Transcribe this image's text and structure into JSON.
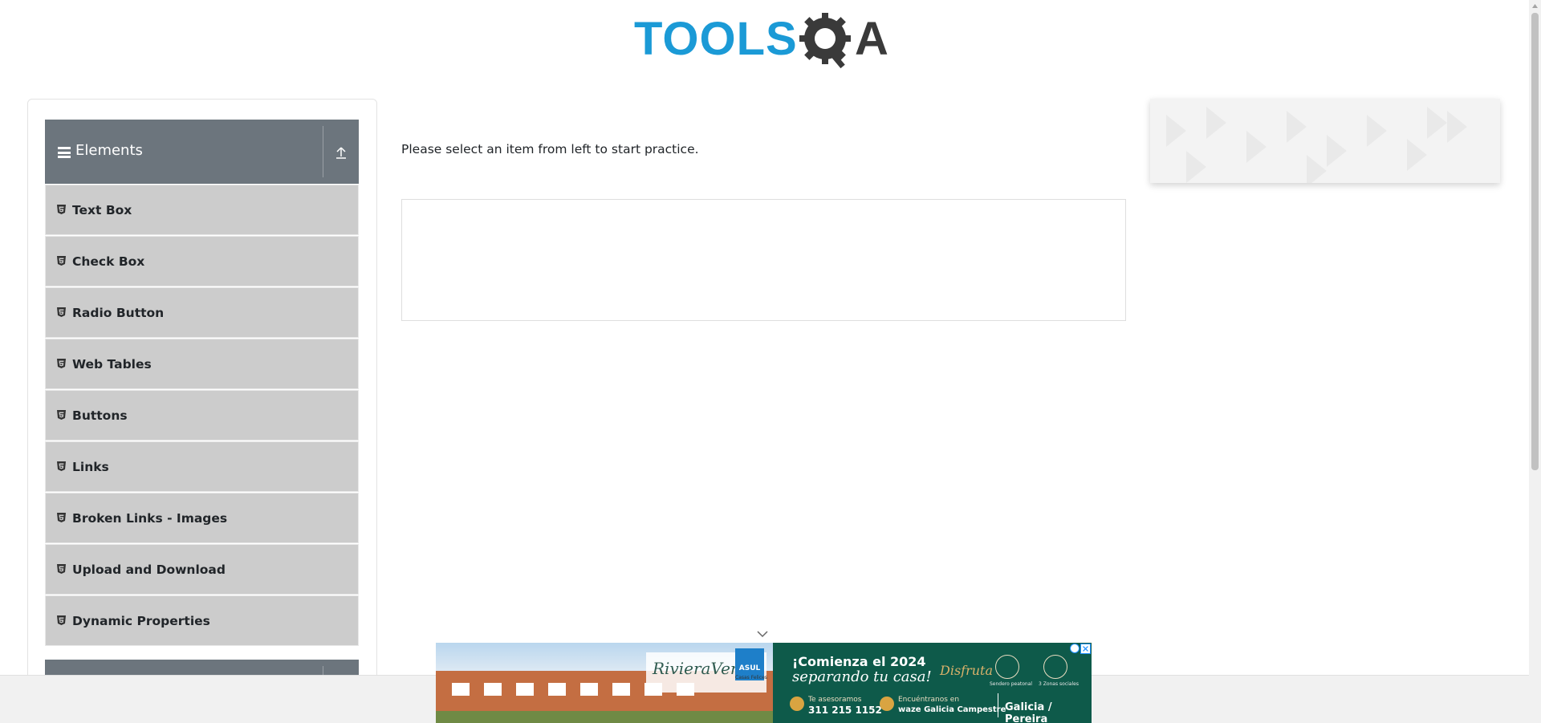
{
  "header": {
    "logo_text_tools": "TOOLS",
    "logo_text_a": "A",
    "logo_colors": {
      "tools": "#1b9ad6",
      "gear": "#3a3a3a"
    }
  },
  "sidebar": {
    "group": {
      "title": "Elements",
      "icon": "hamburger-icon",
      "toggle_icon": "collapse-up-icon"
    },
    "items": [
      {
        "label": "Text Box",
        "icon": "html5-icon"
      },
      {
        "label": "Check Box",
        "icon": "html5-icon"
      },
      {
        "label": "Radio Button",
        "icon": "html5-icon"
      },
      {
        "label": "Web Tables",
        "icon": "html5-icon"
      },
      {
        "label": "Buttons",
        "icon": "html5-icon"
      },
      {
        "label": "Links",
        "icon": "html5-icon"
      },
      {
        "label": "Broken Links - Images",
        "icon": "html5-icon"
      },
      {
        "label": "Upload and Download",
        "icon": "html5-icon"
      },
      {
        "label": "Dynamic Properties",
        "icon": "html5-icon"
      }
    ],
    "colors": {
      "header_bg": "#6c757d",
      "item_bg": "#cccccc"
    }
  },
  "main": {
    "practice_text": "Please select an item from left to start practice."
  },
  "ad": {
    "brand": "RivieraVerde",
    "asul": "ASUL",
    "asul_sub": "Casas Felices",
    "headline": "¡Comienza el 2024",
    "subheadline": "separando tu casa!",
    "disfruta": "Disfruta",
    "amenity_1": "Sendero peatonal",
    "amenity_2": "3 Zonas sociales",
    "phone_label": "Te asesoramos",
    "phone": "311 215 1152",
    "waze_label": "Encuéntranos en",
    "waze_text": "waze Galicia Campestre",
    "city": "Galicia / Pereira"
  }
}
